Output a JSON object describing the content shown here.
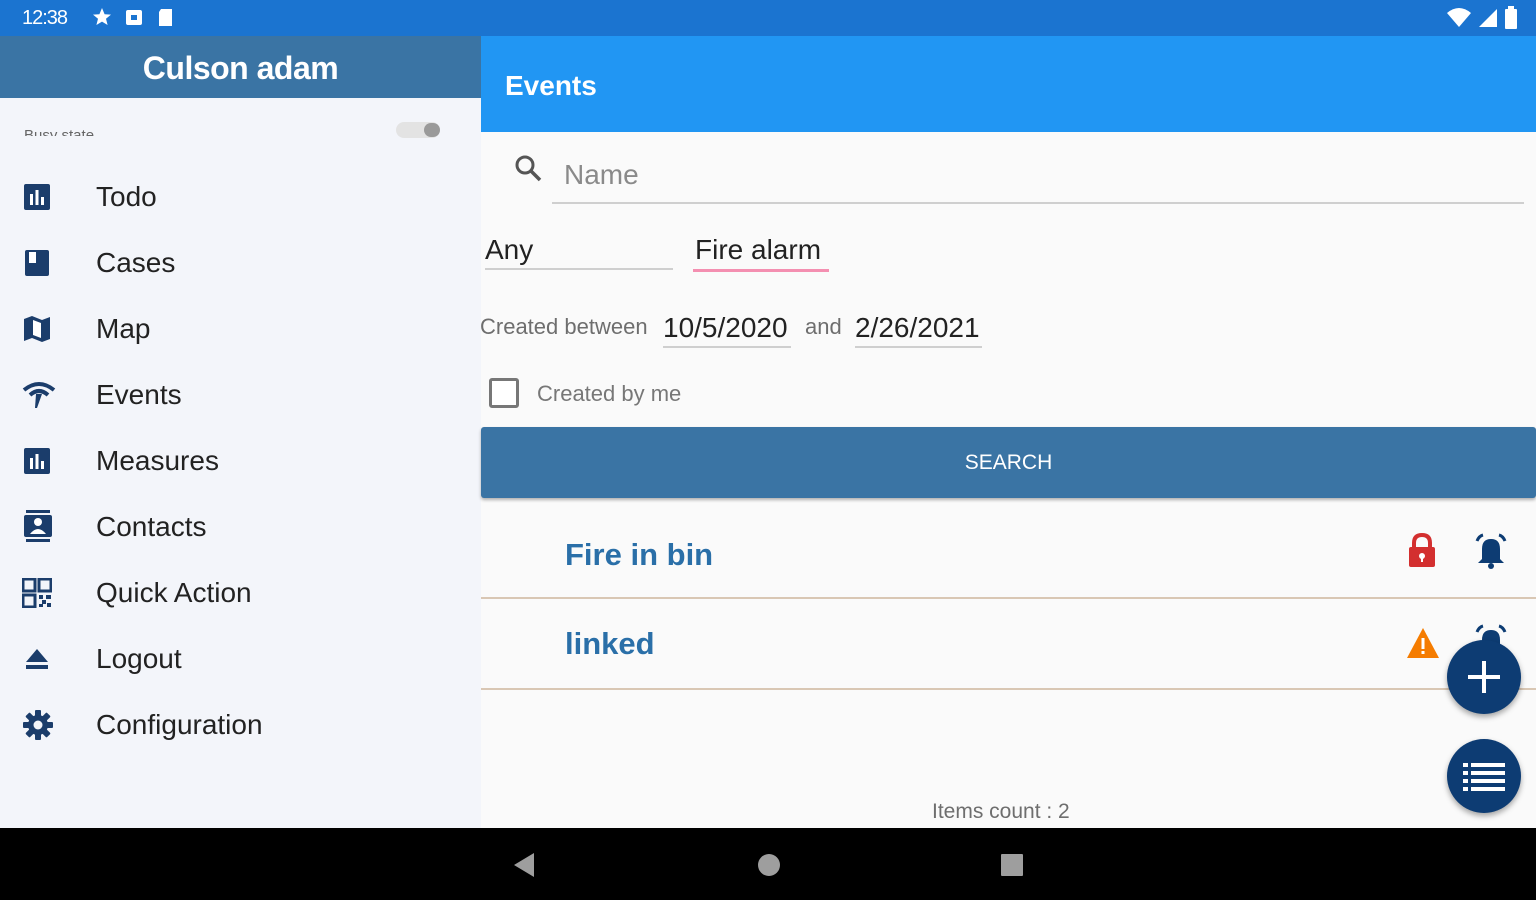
{
  "status_bar": {
    "time": "12:38"
  },
  "drawer": {
    "user_name": "Culson adam",
    "busy_label": "Busy state",
    "busy_on": false,
    "menu": [
      {
        "label": "Todo",
        "icon": "bar-chart-icon"
      },
      {
        "label": "Cases",
        "icon": "book-icon"
      },
      {
        "label": "Map",
        "icon": "map-icon"
      },
      {
        "label": "Events",
        "icon": "signal-icon"
      },
      {
        "label": "Measures",
        "icon": "bar-chart-icon"
      },
      {
        "label": "Contacts",
        "icon": "contacts-icon"
      },
      {
        "label": "Quick Action",
        "icon": "qr-code-icon"
      },
      {
        "label": "Logout",
        "icon": "eject-icon"
      },
      {
        "label": "Configuration",
        "icon": "gear-icon"
      }
    ]
  },
  "main": {
    "title": "Events",
    "search": {
      "placeholder": "Name",
      "value": ""
    },
    "filter_state": "Any",
    "filter_type": "Fire alarm",
    "date_label": "Created between",
    "date_from": "10/5/2020",
    "date_and": "and",
    "date_to": "2/26/2021",
    "created_by_me_label": "Created by me",
    "created_by_me_checked": false,
    "search_button": "SEARCH",
    "results": [
      {
        "title": "Fire in bin",
        "status_icon": "lock-icon",
        "type_icon": "alarm-bell-icon"
      },
      {
        "title": "linked",
        "status_icon": "warning-icon",
        "type_icon": "alarm-bell-icon"
      }
    ],
    "items_count": "Items count : 2"
  },
  "colors": {
    "status_bar": "#1b74d0",
    "appbar": "#2196f3",
    "drawer_header": "#3a74a4",
    "search_button": "#3a74a4",
    "fab": "#0d3c73",
    "result_title": "#2a6fa8",
    "lock": "#d32f2f",
    "warning": "#f57c00"
  }
}
